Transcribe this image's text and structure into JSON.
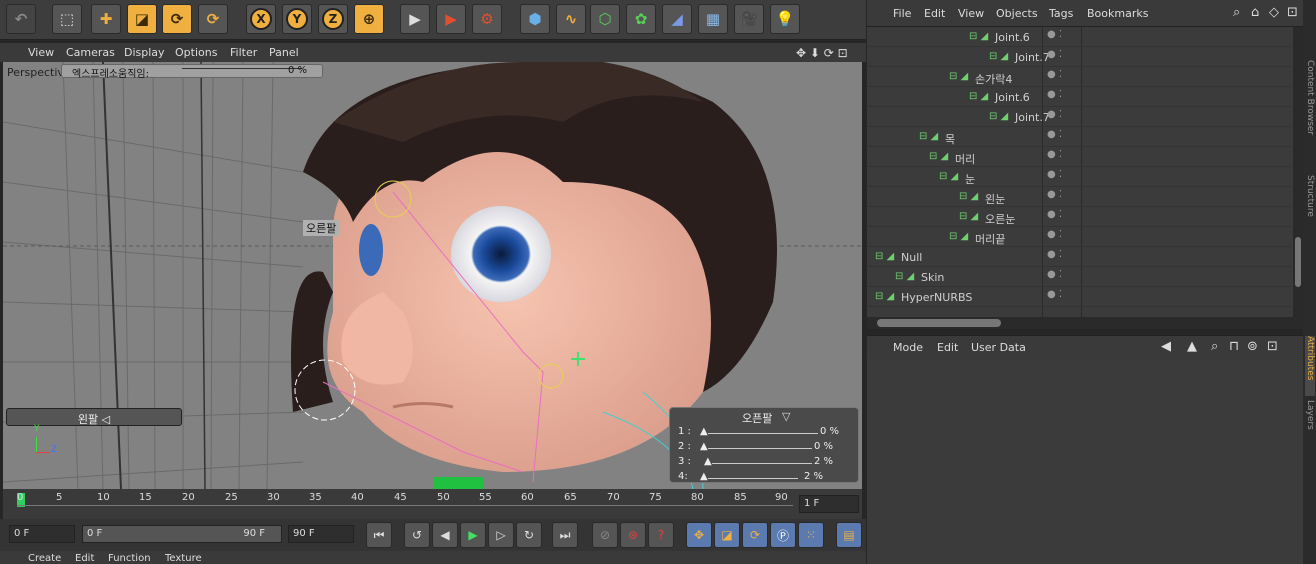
{
  "toolbar": {
    "icons": [
      "undo-icon",
      "live-selection-icon",
      "move-icon",
      "scale-icon",
      "rotate-icon",
      "recent-tool-icon",
      "x-axis-lock-icon",
      "y-axis-lock-icon",
      "z-axis-lock-icon",
      "coordinate-system-icon",
      "render-view-icon",
      "render-to-picture-viewer-icon",
      "render-settings-icon",
      "cube-icon",
      "spline-pen-icon",
      "subdivision-icon",
      "array-icon",
      "deformer-icon",
      "floor-icon",
      "camera-icon",
      "light-icon"
    ],
    "axis_labels": [
      "X",
      "Y",
      "Z"
    ]
  },
  "viewport_menu": {
    "items": [
      "View",
      "Cameras",
      "Display",
      "Options",
      "Filter",
      "Panel"
    ]
  },
  "viewport": {
    "camera_label": "Perspective",
    "slider_top": {
      "label": "엑스프레소움직임:",
      "value": "0 %"
    },
    "label_right_arm": "오른팔",
    "label_left_arm": "왼팔",
    "panel": {
      "title": "오픈팔",
      "rows": [
        {
          "n": "1 :",
          "v": "0 %"
        },
        {
          "n": "2 :",
          "v": "0 %"
        },
        {
          "n": "3 :",
          "v": "2 %"
        },
        {
          "n": "4:",
          "v": "2 %"
        }
      ]
    },
    "axis": {
      "y": "Y",
      "z": "Z"
    }
  },
  "timeline": {
    "ticks": [
      "0",
      "5",
      "10",
      "15",
      "20",
      "25",
      "30",
      "35",
      "40",
      "45",
      "50",
      "55",
      "60",
      "65",
      "70",
      "75",
      "80",
      "85",
      "90"
    ],
    "current_frame": "1 F"
  },
  "transport": {
    "start": "0 F",
    "range_start": "0 F",
    "range_end": "90 F",
    "end": "90 F"
  },
  "material_menu": {
    "items": [
      "Create",
      "Edit",
      "Function",
      "Texture"
    ]
  },
  "object_menu": {
    "items": [
      "File",
      "Edit",
      "View",
      "Objects",
      "Tags",
      "Bookmarks"
    ]
  },
  "object_tree": [
    {
      "name": "Joint.6",
      "indent": 100
    },
    {
      "name": "Joint.7",
      "indent": 120
    },
    {
      "name": "손가락4",
      "indent": 80
    },
    {
      "name": "Joint.6",
      "indent": 100
    },
    {
      "name": "Joint.7",
      "indent": 120
    },
    {
      "name": "목",
      "indent": 50
    },
    {
      "name": "머리",
      "indent": 60
    },
    {
      "name": "눈",
      "indent": 70
    },
    {
      "name": "왼눈",
      "indent": 90
    },
    {
      "name": "오른눈",
      "indent": 90
    },
    {
      "name": "머리끝",
      "indent": 80
    },
    {
      "name": "Null",
      "indent": 6
    },
    {
      "name": "Skin",
      "indent": 26
    },
    {
      "name": "HyperNURBS",
      "indent": 6
    }
  ],
  "attribute_menu": {
    "items": [
      "Mode",
      "Edit",
      "User Data"
    ]
  },
  "side_tabs": [
    "Attributes",
    "Layers",
    "Content Browser",
    "Structure"
  ]
}
